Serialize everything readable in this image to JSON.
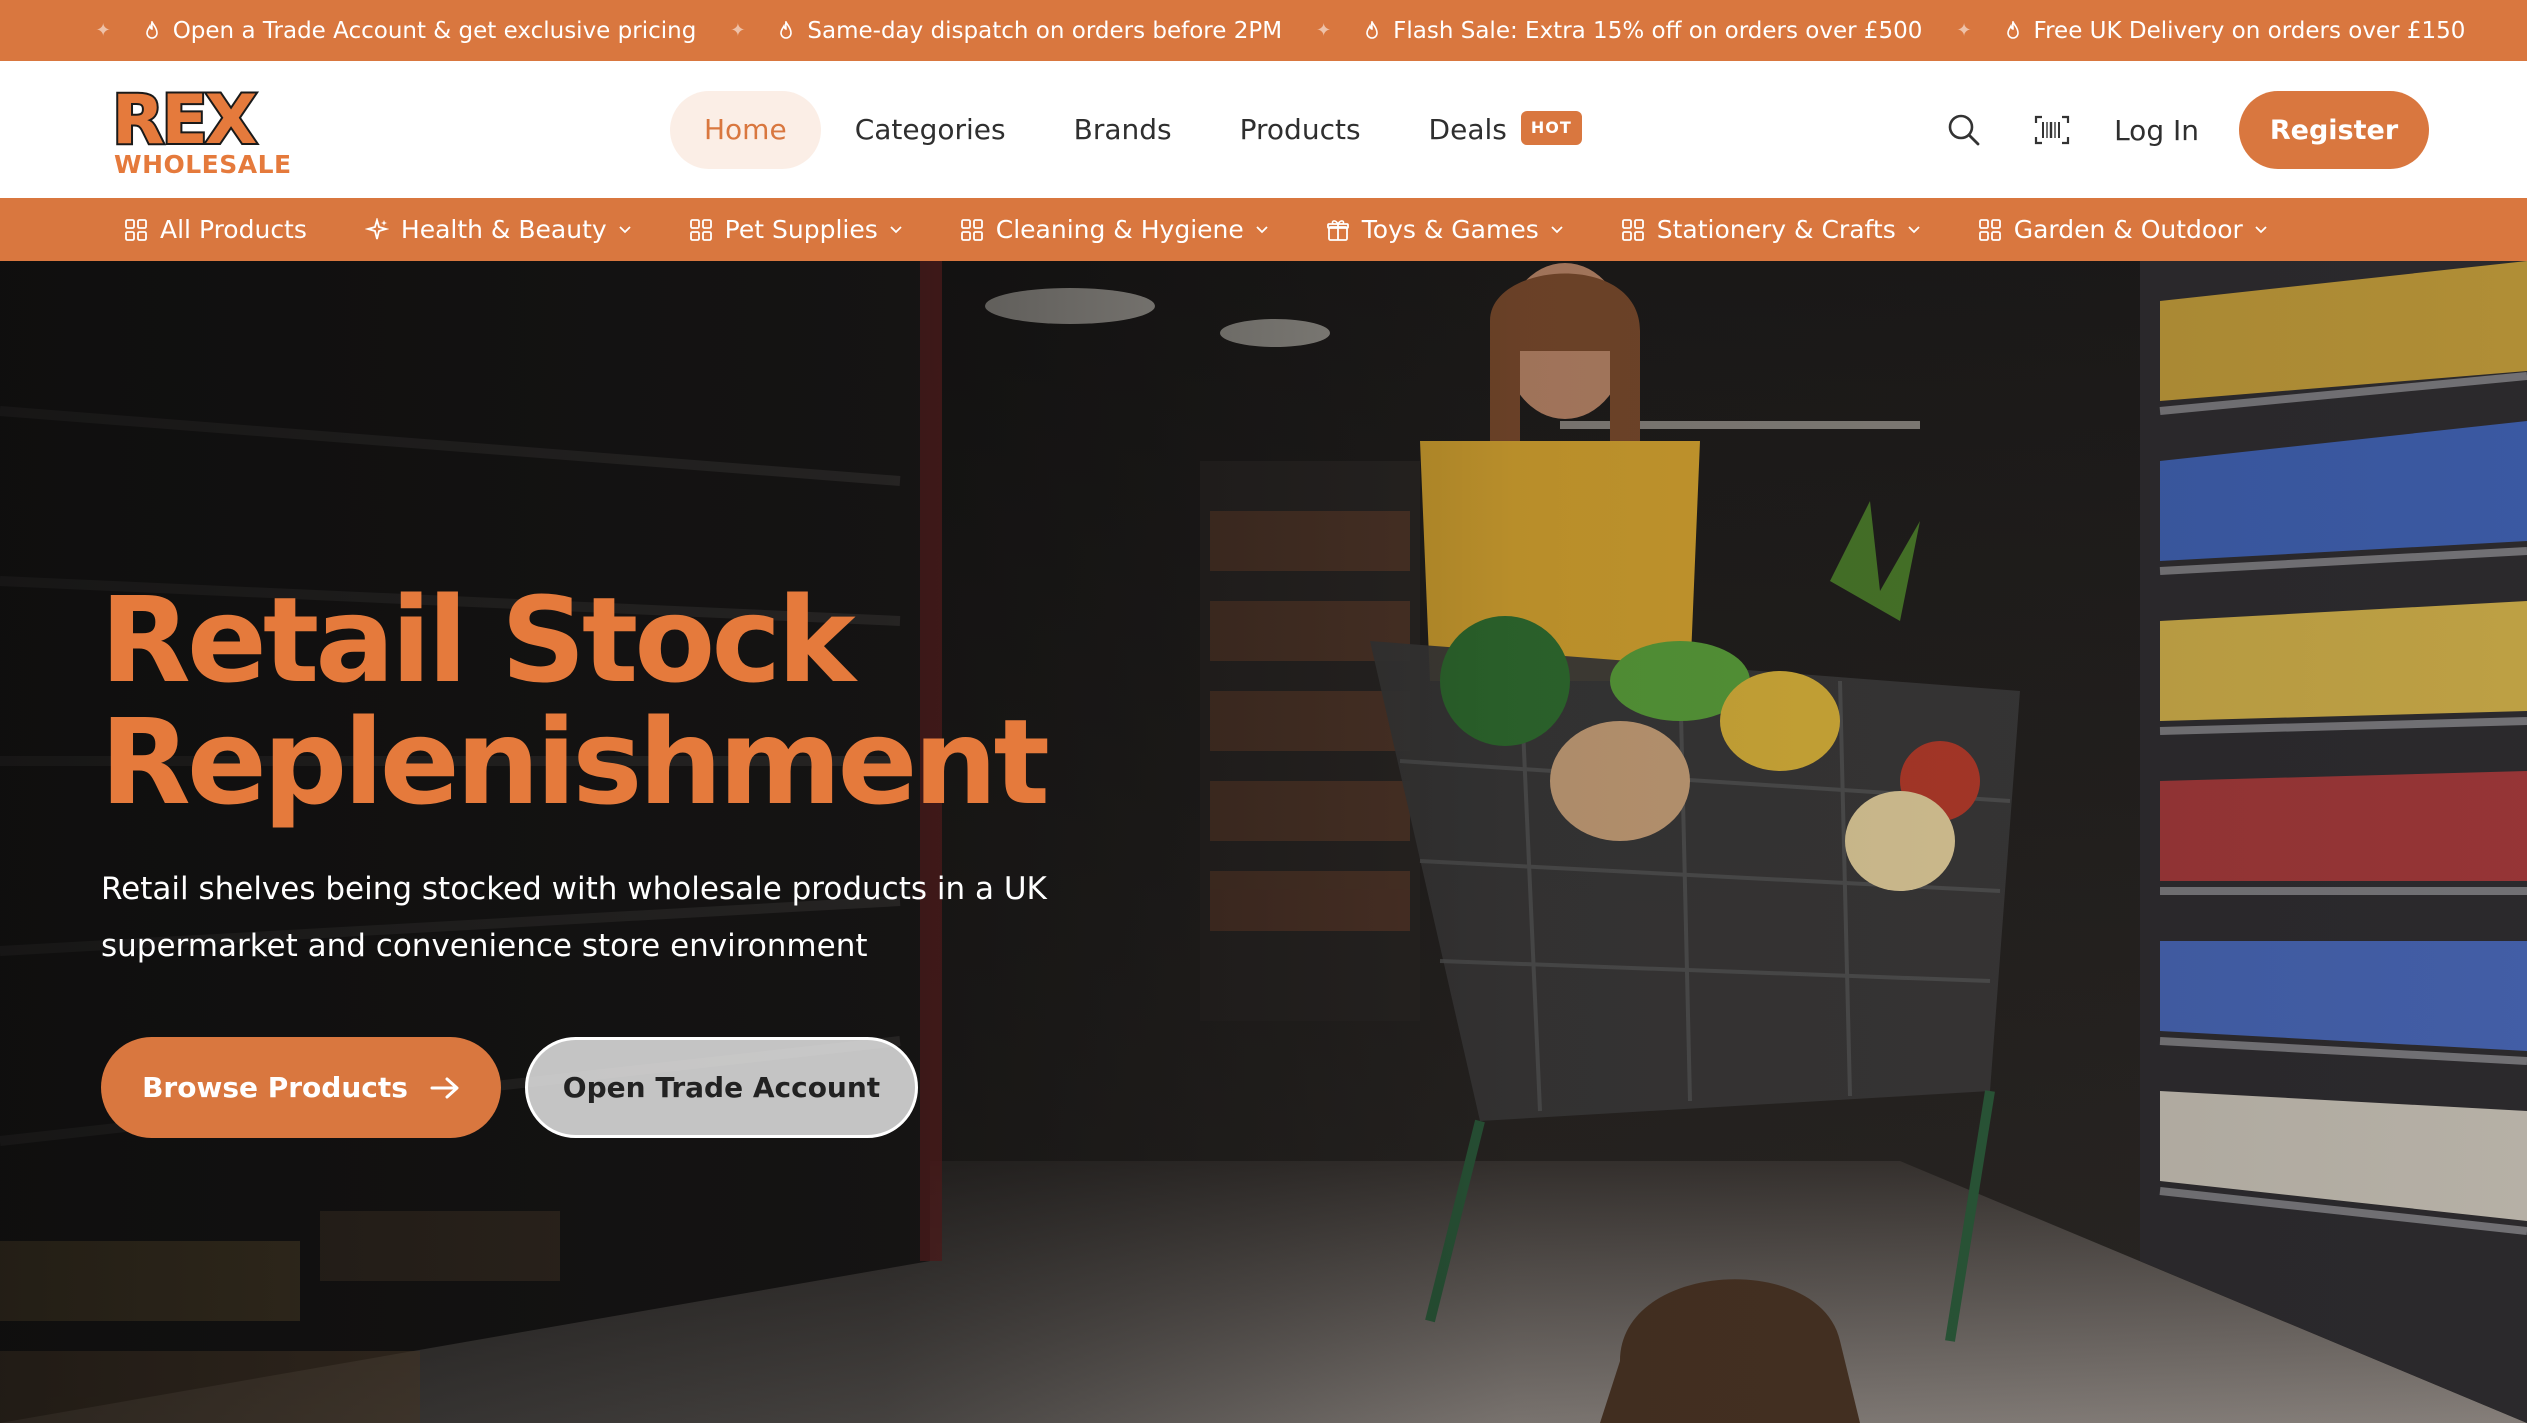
{
  "announcement": {
    "items": [
      "Open a Trade Account & get exclusive pricing",
      "Same-day dispatch on orders before 2PM",
      "Flash Sale: Extra 15% off on orders over £500",
      "Free UK Delivery on orders over £150"
    ],
    "icon": "flame-icon"
  },
  "brand": {
    "logo_top": "REX",
    "logo_bottom": "WHOLESALE"
  },
  "nav": {
    "items": [
      "Home",
      "Categories",
      "Brands",
      "Products",
      "Deals"
    ],
    "active": "Home",
    "deals_badge": "HOT"
  },
  "header_actions": {
    "search_icon": "search-icon",
    "barcode_icon": "barcode-scanner-icon",
    "login": "Log In",
    "register": "Register"
  },
  "categories": [
    {
      "label": "All Products",
      "icon": "grid-icon",
      "dropdown": false
    },
    {
      "label": "Health & Beauty",
      "icon": "sparkle-icon",
      "dropdown": true
    },
    {
      "label": "Pet Supplies",
      "icon": "grid-icon",
      "dropdown": true
    },
    {
      "label": "Cleaning & Hygiene",
      "icon": "grid-icon",
      "dropdown": true
    },
    {
      "label": "Toys & Games",
      "icon": "gift-icon",
      "dropdown": true
    },
    {
      "label": "Stationery & Crafts",
      "icon": "grid-icon",
      "dropdown": true
    },
    {
      "label": "Garden & Outdoor",
      "icon": "grid-icon",
      "dropdown": true
    }
  ],
  "hero": {
    "title_line1": "Retail Stock",
    "title_line2": "Replenishment",
    "subtitle": "Retail shelves being stocked with wholesale products in a UK supermarket and convenience store environment",
    "primary_button": "Browse Products",
    "secondary_button": "Open Trade Account"
  },
  "colors": {
    "brand_orange": "#d9773f",
    "title_orange": "#e57a3c",
    "active_nav_bg": "#fbeee6"
  }
}
